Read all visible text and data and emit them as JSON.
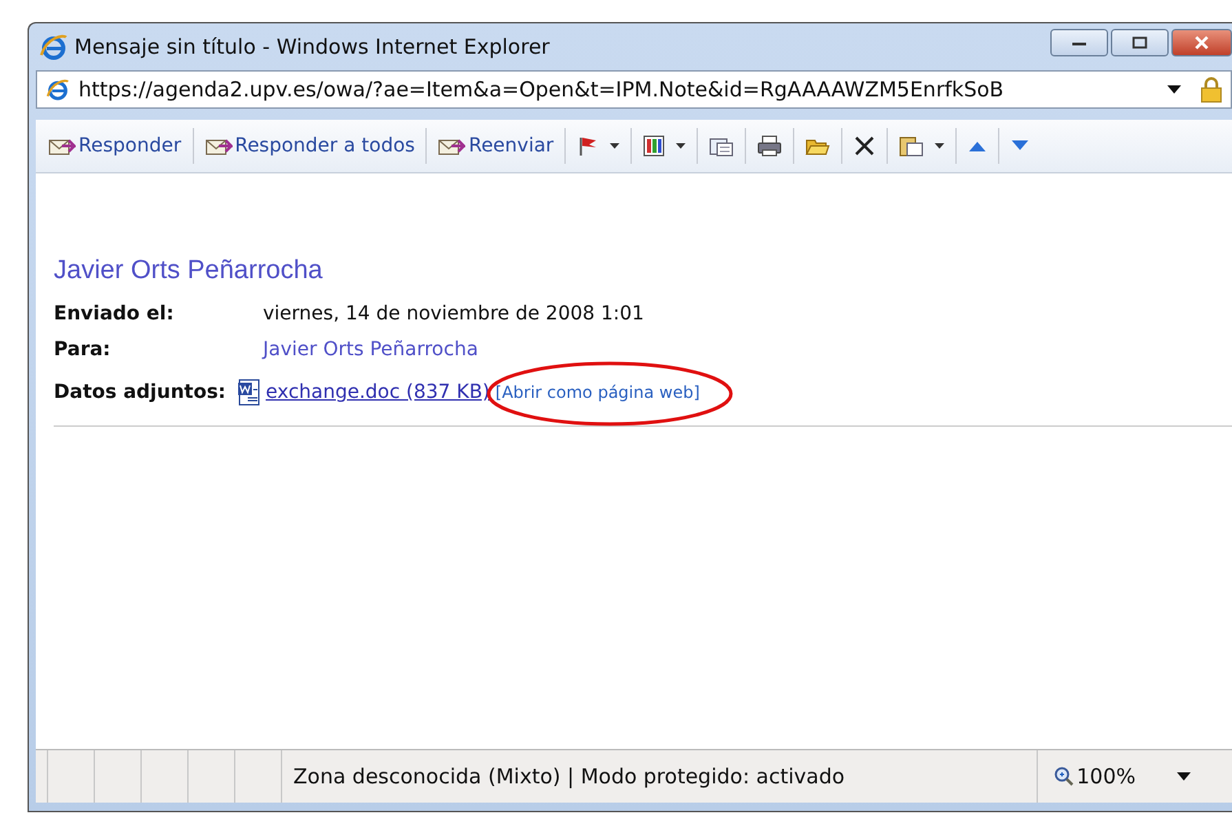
{
  "window": {
    "title": "Mensaje sin título - Windows Internet Explorer"
  },
  "address_bar": {
    "url": "https://agenda2.upv.es/owa/?ae=Item&a=Open&t=IPM.Note&id=RgAAAAWZM5EnrfkSoB"
  },
  "toolbar": [
    {
      "kind": "text",
      "label": "Responder",
      "dropdown": false
    },
    {
      "kind": "text",
      "label": "Responder a todos",
      "dropdown": false
    },
    {
      "kind": "text",
      "label": "Reenviar",
      "dropdown": false
    },
    {
      "kind": "icon",
      "dropdown": true
    },
    {
      "kind": "icon",
      "dropdown": true
    },
    {
      "kind": "icon",
      "dropdown": false
    },
    {
      "kind": "icon",
      "dropdown": false
    },
    {
      "kind": "icon",
      "dropdown": false
    },
    {
      "kind": "icon",
      "dropdown": false
    },
    {
      "kind": "icon",
      "dropdown": true
    },
    {
      "kind": "icon",
      "dropdown": false
    },
    {
      "kind": "icon",
      "dropdown": false
    }
  ],
  "message": {
    "sender": "Javier Orts Peñarrocha",
    "fields": [
      {
        "label": "Enviado el:",
        "value": "viernes, 14 de noviembre de 2008 1:01",
        "kind": "text"
      },
      {
        "label": "Para:",
        "value": "Javier Orts Peñarrocha",
        "kind": "link"
      }
    ],
    "attachments": {
      "label": "Datos adjuntos:",
      "file": "exchange.doc (837 KB)",
      "action": "[Abrir como página web]",
      "highlighted": true
    }
  },
  "status_bar": {
    "zone": "Zona desconocida (Mixto) | Modo protegido: activado",
    "zoom": "100%"
  }
}
